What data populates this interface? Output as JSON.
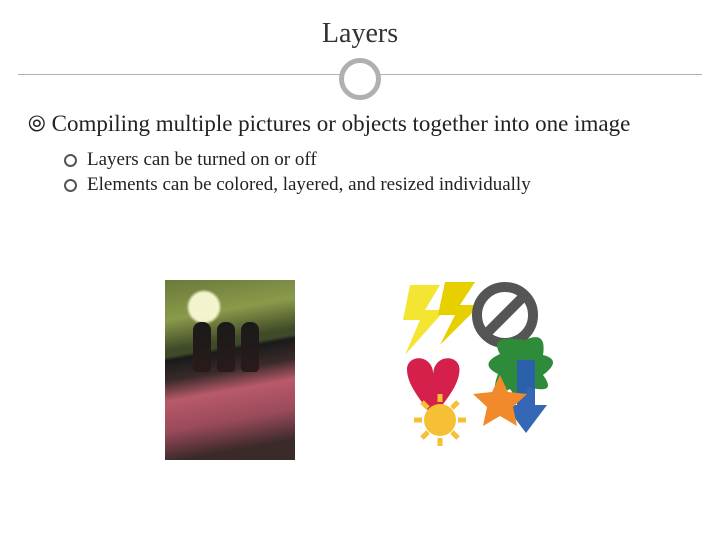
{
  "title": "Layers",
  "main_bullet_glyph": "~",
  "main_bullet": "Compiling multiple pictures or objects together into one image",
  "sub_bullets": [
    "Layers can be turned on or off",
    "Elements can be colored, layered, and resized individually"
  ],
  "images": {
    "left_alt": "three-figures-photo",
    "right_alt": "colorful-shapes-collage"
  }
}
